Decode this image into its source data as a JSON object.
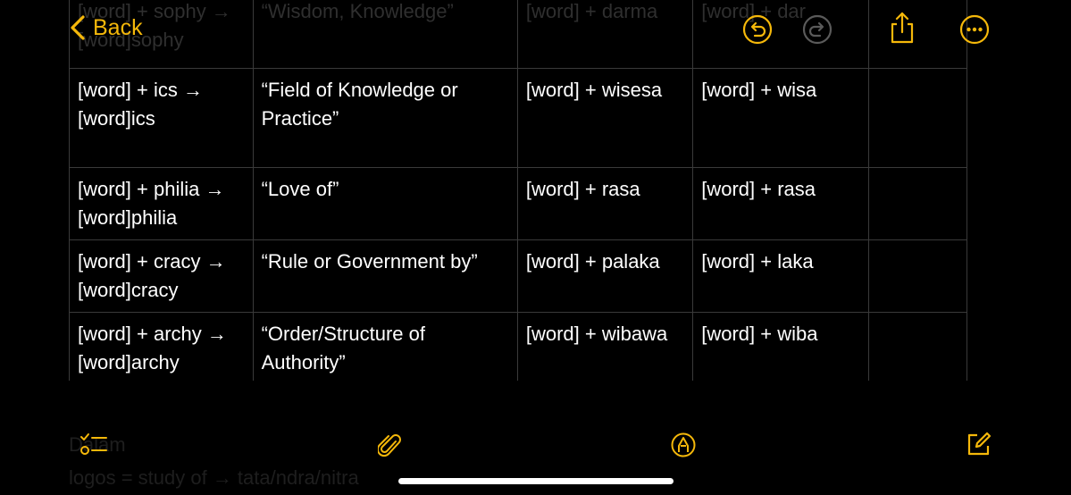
{
  "toolbar": {
    "back_label": "Back"
  },
  "icons": {
    "undo": "undo-icon",
    "redo": "redo-icon",
    "share": "share-icon",
    "more": "ellipsis-icon",
    "checklist": "checklist-icon",
    "attach": "paperclip-icon",
    "markup": "markup-pen-icon",
    "compose": "compose-icon"
  },
  "colors": {
    "accent": "#f5b80a",
    "background": "#000000",
    "grid": "#3a3a3a"
  },
  "table": {
    "rows": [
      {
        "c1": "[word] + sophy → [word]sophy",
        "c2": "“Wisdom, Knowledge”",
        "c3": "[word] + darma",
        "c4": "[word] + dar",
        "c5": ""
      },
      {
        "c1": "[word] + ics → [word]ics",
        "c2": "“Field of Knowledge or Practice”",
        "c3": "[word] + wisesa",
        "c4": "[word] + wisa",
        "c5": ""
      },
      {
        "c1": "[word] + philia → [word]philia",
        "c2": "“Love of”",
        "c3": "[word] + rasa",
        "c4": "[word] + rasa",
        "c5": ""
      },
      {
        "c1": "[word] + cracy → [word]cracy",
        "c2": "“Rule or Government by”",
        "c3": "[word] + palaka",
        "c4": "[word] + laka",
        "c5": ""
      },
      {
        "c1": "[word] + archy → [word]archy",
        "c2": "“Order/Structure of Authority”",
        "c3": "[word] + wibawa",
        "c4": "[word] + wiba",
        "c5": ""
      }
    ]
  },
  "below_text": {
    "line1": "Dalam",
    "line2": "logos = study of → tata/ndra/nitra"
  }
}
